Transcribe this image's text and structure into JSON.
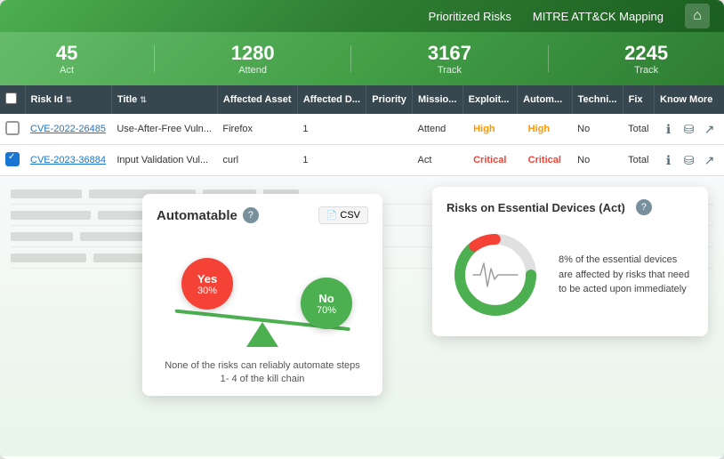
{
  "topNav": {
    "links": [
      "Prioritized Risks",
      "MITRE ATT&CK Mapping"
    ],
    "homeIcon": "⌂"
  },
  "statsBar": {
    "items": [
      {
        "number": "45",
        "label": "Act"
      },
      {
        "number": "1280",
        "label": "Attend"
      },
      {
        "number": "3167",
        "label": "Track"
      },
      {
        "number": "2245",
        "label": "Track"
      }
    ]
  },
  "table": {
    "columns": [
      "Risk Id",
      "Title",
      "Affected Asset",
      "Affected D...",
      "Priority",
      "Missio...",
      "Exploit...",
      "Autom...",
      "Techni...",
      "Fix",
      "Know More"
    ],
    "rows": [
      {
        "checkbox": false,
        "riskId": "CVE-2022-26485",
        "title": "Use-After-Free Vuln...",
        "asset": "Firefox",
        "affectedD": "1",
        "priority": "",
        "mission": "Attend",
        "exploit": "High",
        "autom": "High",
        "techni": "No",
        "fix": "Total",
        "exploitColor": "orange",
        "automColor": "orange"
      },
      {
        "checkbox": true,
        "riskId": "CVE-2023-36884",
        "title": "Input Validation Vul...",
        "asset": "curl",
        "affectedD": "1",
        "priority": "",
        "mission": "Act",
        "exploit": "Critical",
        "autom": "Critical",
        "techni": "No",
        "fix": "Total",
        "exploitColor": "red",
        "automColor": "red"
      }
    ]
  },
  "automatableWidget": {
    "title": "Automatable",
    "helpIcon": "?",
    "csvLabel": "CSV",
    "yesLabel": "Yes",
    "yesPercent": "30%",
    "noLabel": "No",
    "noPercent": "70%",
    "caption": "None of the risks can reliably automate steps\n1- 4 of the kill chain"
  },
  "essentialWidget": {
    "title": "Risks on Essential Devices (Act)",
    "helpIcon": "?",
    "gaugePercent": 8,
    "description": "8% of the essential devices are affected by risks that need to be acted upon immediately"
  }
}
